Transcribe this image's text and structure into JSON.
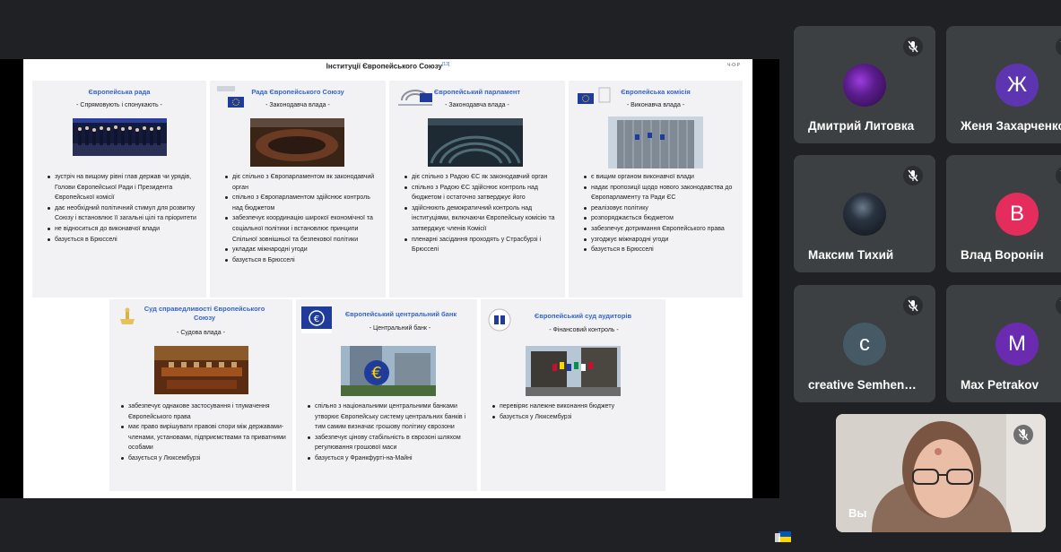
{
  "slide": {
    "title": "Інституції Європейського Союзу",
    "title_ref": "[13]",
    "edit_link": "Ч·О·Р",
    "cells": [
      {
        "name": "Європейська рада",
        "sub": "- Спрямовують і спонукають -",
        "items": [
          "зустріч на вищому рівні глав держав чи урядів, Голови Європейської Ради і Президента Європейської комісії",
          "дає необхідний політичний стимул для розвитку Союзу і встановлює її загальні цілі та пріоритети",
          "не відноситься до виконавчої влади",
          "базується в Брюсселі"
        ]
      },
      {
        "name": "Рада Європейського Союзу",
        "sub": "- Законодавча влада -",
        "items": [
          "діє спільно з Європарламентом як законодавчий орган",
          "спільно з Європарламентом здійснює контроль над бюджетом",
          "забезпечує координацію широкої економічної та соціальної політики і встановлює принципи Спільної зовнішньої та безпекової політики",
          "укладає міжнародні угоди",
          "базується в Брюсселі"
        ]
      },
      {
        "name": "Європейський парламент",
        "sub": "- Законодавча влада -",
        "items": [
          "діє спільно з Радою ЄС як законодавчий орган",
          "спільно з Радою ЄС здійснює контроль над бюджетом і остаточно затверджує його",
          "здійснюють демократичний контроль над інституціями, включаючи Європейську комісію та затверджує членів Комісії",
          "пленарні засідання проходять у Страсбурзі і Брюсселі"
        ]
      },
      {
        "name": "Європейська комісія",
        "sub": "- Виконавча влада -",
        "items": [
          "є вищим органом виконавчої влади",
          "надає пропозиції щодо нового законодавства до Європарламенту та Ради ЄС",
          "реалізовує політику",
          "розпоряджається бюджетом",
          "забезпечує дотримання Європейського права",
          "узгоджує міжнародні угоди",
          "базується в Брюсселі"
        ]
      },
      {
        "name": "Суд справедливості Європейського Союзу",
        "sub": "- Судова влада -",
        "items": [
          "забезпечує однакове застосування і тлумачення Європейського права",
          "має право вирішувати правові спори між державами-членами, установами, підприємствами та приватними особами",
          "базується у Люксембурзі"
        ]
      },
      {
        "name": "Європейський центральний банк",
        "sub": "- Центральний банк -",
        "items": [
          "спільно з національними центральними банками утворює Європейську систему центральних банків і тим самим визначає грошову політику єврозони",
          "забезпечує цінову стабільність в єврозоні шляхом регулювання грошової маси",
          "базується у Франкфурті-на-Майні"
        ]
      },
      {
        "name": "Європейський суд аудиторів",
        "sub": "- Фінансовий контроль -",
        "items": [
          "перевіряє належне виконання бюджету",
          "базується у Люксембурзі"
        ]
      }
    ]
  },
  "participants": [
    {
      "name": "Дмитрий Литовка",
      "initial": "",
      "avatar_color": "#5b1d8c"
    },
    {
      "name": "Женя Захарченко",
      "initial": "Ж",
      "avatar_color": "#5e35b1"
    },
    {
      "name": "Максим Тихий",
      "initial": "",
      "avatar_color": "#1b2430"
    },
    {
      "name": "Влад Воронін",
      "initial": "В",
      "avatar_color": "#e52d5d"
    },
    {
      "name": "creative Semhen…",
      "initial": "c",
      "avatar_color": "#455a64"
    },
    {
      "name": "Max Petrakov",
      "initial": "M",
      "avatar_color": "#6a2bb0"
    }
  ],
  "self": {
    "name": "Вы"
  },
  "colors": {
    "link": "#3366cc",
    "tile": "#3c4043",
    "background": "#202124"
  }
}
